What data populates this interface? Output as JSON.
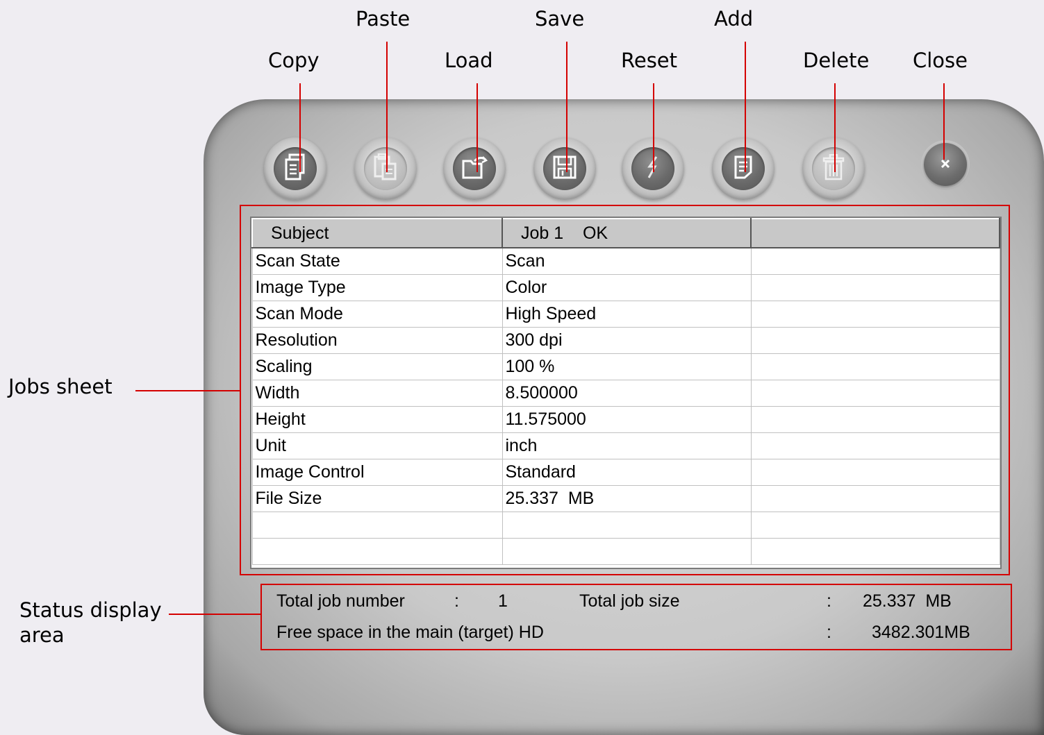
{
  "callouts": {
    "copy": "Copy",
    "paste": "Paste",
    "load": "Load",
    "save": "Save",
    "reset": "Reset",
    "add": "Add",
    "delete": "Delete",
    "close": "Close",
    "jobs_sheet": "Jobs sheet",
    "status_line1": "Status display",
    "status_line2": "area"
  },
  "toolbar": {
    "icons": [
      "copy-icon",
      "paste-icon",
      "load-icon",
      "save-icon",
      "reset-icon",
      "add-icon",
      "delete-icon",
      "close-icon"
    ],
    "disabled": [
      "paste",
      "delete"
    ]
  },
  "sheet": {
    "columns": [
      "Subject",
      "Job 1    OK",
      ""
    ],
    "rows": [
      [
        "Scan State",
        "Scan",
        ""
      ],
      [
        "Image Type",
        "Color",
        ""
      ],
      [
        "Scan Mode",
        "High Speed",
        ""
      ],
      [
        "Resolution",
        "300 dpi",
        ""
      ],
      [
        "Scaling",
        "100 %",
        ""
      ],
      [
        "Width",
        "8.500000",
        ""
      ],
      [
        "Height",
        "11.575000",
        ""
      ],
      [
        "Unit",
        "inch",
        ""
      ],
      [
        "Image Control",
        "Standard",
        ""
      ],
      [
        "File Size",
        "25.337  MB",
        ""
      ],
      [
        "",
        "",
        ""
      ],
      [
        "",
        "",
        ""
      ]
    ]
  },
  "status": {
    "total_job_number_label": "Total job number",
    "total_job_number_sep": ":",
    "total_job_number_value": "1",
    "total_job_size_label": "Total job size",
    "total_job_size_sep": ":",
    "total_job_size_value": "25.337  MB",
    "free_space_label": "Free space in the main (target) HD",
    "free_space_sep": ":",
    "free_space_value": "3482.301MB"
  },
  "colors": {
    "annotation_red": "#d40000",
    "page_background": "#efedf2"
  }
}
